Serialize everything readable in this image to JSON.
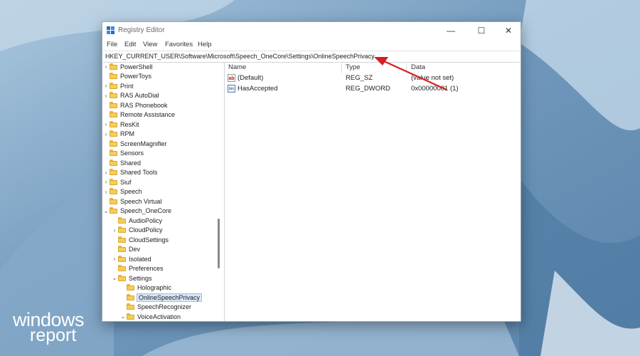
{
  "window": {
    "title": "Registry Editor",
    "controls": {
      "minimize": "—",
      "maximize": "☐",
      "close": "✕"
    }
  },
  "menu": [
    "File",
    "Edit",
    "View",
    "Favorites",
    "Help"
  ],
  "address": "HKEY_CURRENT_USER\\Software\\Microsoft\\Speech_OneCore\\Settings\\OnlineSpeechPrivacy",
  "tree": [
    {
      "label": "PowerShell",
      "expander": "›"
    },
    {
      "label": "PowerToys",
      "expander": ""
    },
    {
      "label": "Print",
      "expander": "›"
    },
    {
      "label": "RAS AutoDial",
      "expander": "›"
    },
    {
      "label": "RAS Phonebook",
      "expander": ""
    },
    {
      "label": "Remote Assistance",
      "expander": ""
    },
    {
      "label": "ResKit",
      "expander": "›"
    },
    {
      "label": "RPM",
      "expander": "›"
    },
    {
      "label": "ScreenMagnifier",
      "expander": ""
    },
    {
      "label": "Sensors",
      "expander": ""
    },
    {
      "label": "Shared",
      "expander": ""
    },
    {
      "label": "Shared Tools",
      "expander": "›"
    },
    {
      "label": "Siuf",
      "expander": "›"
    },
    {
      "label": "Speech",
      "expander": "›"
    },
    {
      "label": "Speech Virtual",
      "expander": ""
    },
    {
      "label": "Speech_OneCore",
      "expander": "⌄"
    },
    {
      "label": "AudioPolicy",
      "expander": ""
    },
    {
      "label": "CloudPolicy",
      "expander": "›"
    },
    {
      "label": "CloudSettings",
      "expander": ""
    },
    {
      "label": "Dev",
      "expander": ""
    },
    {
      "label": "Isolated",
      "expander": "›"
    },
    {
      "label": "Preferences",
      "expander": ""
    },
    {
      "label": "Settings",
      "expander": "⌄"
    },
    {
      "label": "Holographic",
      "expander": ""
    },
    {
      "label": "OnlineSpeechPrivacy",
      "expander": ""
    },
    {
      "label": "SpeechRecognizer",
      "expander": ""
    },
    {
      "label": "VoiceActivation",
      "expander": "⌄"
    }
  ],
  "list": {
    "headers": {
      "name": "Name",
      "type": "Type",
      "data": "Data"
    },
    "rows": [
      {
        "icon": "ab",
        "name": "(Default)",
        "type": "REG_SZ",
        "data": "(value not set)"
      },
      {
        "icon": "bin",
        "name": "HasAccepted",
        "type": "REG_DWORD",
        "data": "0x00000001 (1)"
      }
    ]
  },
  "icons": {
    "app": "registry-editor-icon",
    "folder": "folder-icon",
    "string_value": "string-value-icon",
    "binary_value": "binary-value-icon"
  },
  "colors": {
    "arrow": "#d61f1f",
    "folder": "#f5cd5a",
    "selection": "#d8e6f7"
  },
  "logo": {
    "line1": "windows",
    "line2": "report"
  }
}
